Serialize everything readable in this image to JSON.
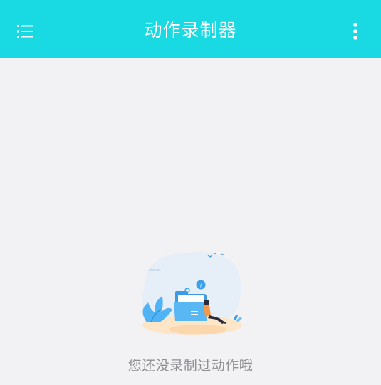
{
  "app_bar": {
    "title": "动作录制器",
    "background": "#19d9e2",
    "left_icon": "list-menu-icon",
    "right_icon": "more-vertical-icon"
  },
  "empty_state": {
    "illustration": "empty-folder-illustration",
    "message": "您还没录制过动作哦"
  },
  "colors": {
    "page_background": "#f2f1f4",
    "message_text": "#8f8f94"
  }
}
